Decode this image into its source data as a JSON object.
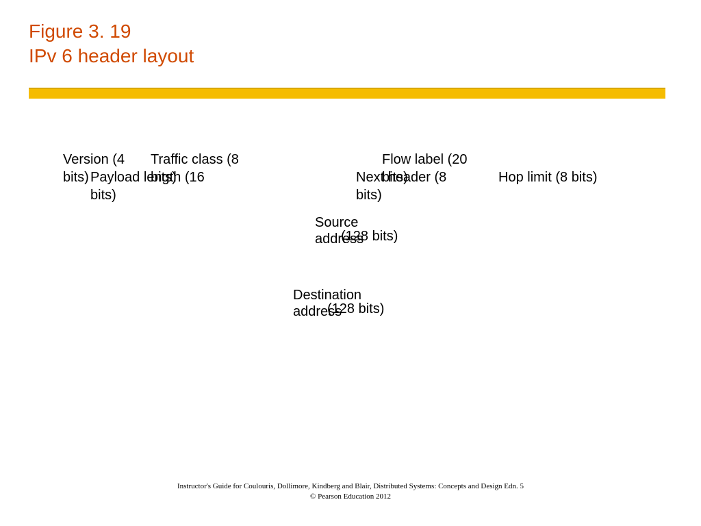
{
  "title": {
    "line1": "Figure 3. 19",
    "line2": "IPv 6 header layout"
  },
  "chart_data": {
    "type": "table",
    "title": "IPv6 header layout",
    "fields": [
      {
        "name": "Version",
        "bits": 4
      },
      {
        "name": "Traffic class",
        "bits": 8
      },
      {
        "name": "Flow label",
        "bits": 20
      },
      {
        "name": "Payload length",
        "bits": 16
      },
      {
        "name": "Next header",
        "bits": 8
      },
      {
        "name": "Hop limit",
        "bits": 8
      },
      {
        "name": "Source address",
        "bits": 128
      },
      {
        "name": "Destination address",
        "bits": 128
      }
    ]
  },
  "layout": {
    "row1": {
      "version_a": "Version (4",
      "traffic_a": "Traffic class (8",
      "flow_a": "Flow label (20"
    },
    "row2": {
      "version_b": "bits)",
      "traffic_b": "bits)",
      "payload_a": "Payload length (16",
      "flow_b": "bits)",
      "next_a": "Next header (8",
      "hop": "Hop limit (8 bits)"
    },
    "row3": {
      "payload_b": "bits)",
      "next_b": "bits)"
    },
    "src": {
      "a": "Source",
      "b": "address",
      "c": "(128 bits)"
    },
    "dst": {
      "a": "Destination",
      "b": "address",
      "c": "(128 bits)"
    }
  },
  "footer": {
    "line1": "Instructor's Guide for  Coulouris, Dollimore, Kindberg and Blair,  Distributed Systems: Concepts and Design   Edn. 5",
    "line2": "©  Pearson Education 2012"
  }
}
